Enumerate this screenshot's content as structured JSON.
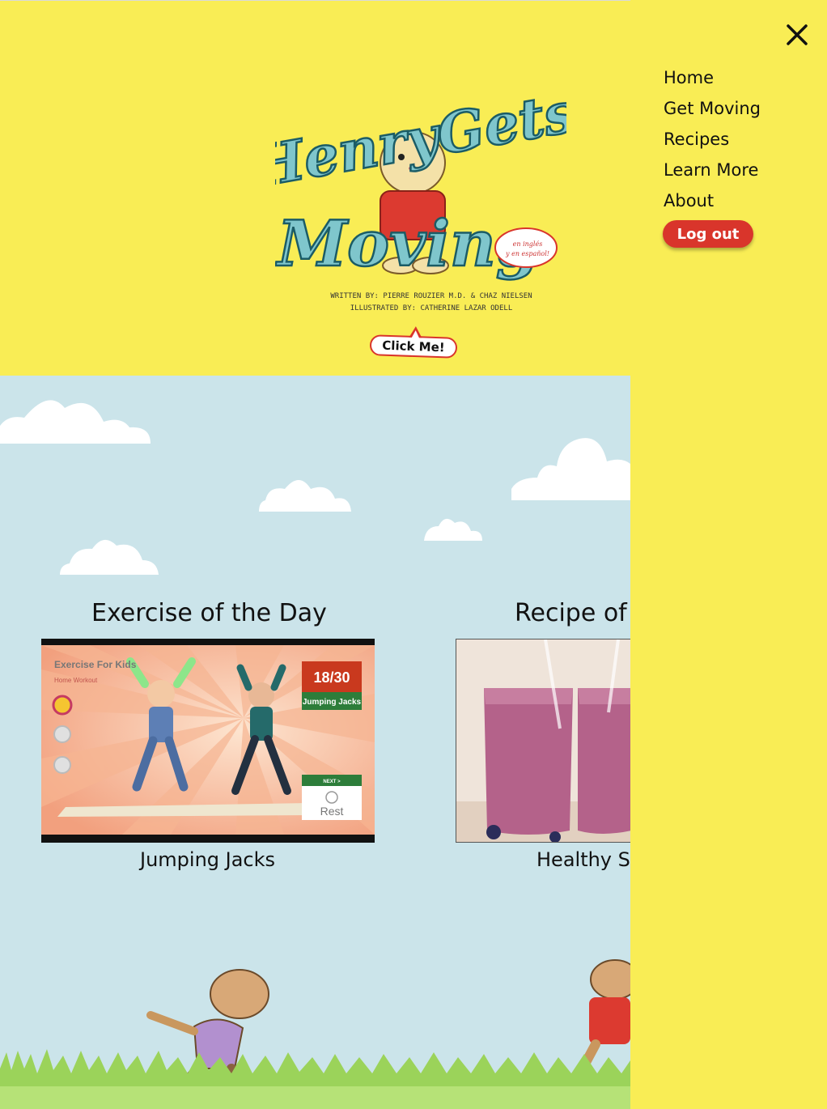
{
  "header": {
    "logo_title_line1": "HenryGets",
    "logo_title_line2": "Moving",
    "logo_bubble_line1": "en inglés",
    "logo_bubble_line2": "y en español!",
    "logo_credit_written": "WRITTEN BY: PIERRE ROUZIER M.D. & CHAZ NIELSEN",
    "logo_credit_illustrated": "ILLUSTRATED BY: CATHERINE LAZAR ODELL",
    "click_me_label": "Click Me!"
  },
  "nav": {
    "close_icon": "close-icon",
    "items": [
      {
        "label": "Home"
      },
      {
        "label": "Get Moving"
      },
      {
        "label": "Recipes"
      },
      {
        "label": "Learn More"
      },
      {
        "label": "About"
      }
    ],
    "logout_label": "Log out"
  },
  "exercise": {
    "section_title": "Exercise of the Day",
    "video_title": "Exercise For Kids",
    "video_subtitle": "Home Workout",
    "counter": "18/30",
    "exercise_label": "Jumping Jacks",
    "next_label": "NEXT >",
    "rest_label": "Rest",
    "caption": "Jumping Jacks"
  },
  "recipe": {
    "section_title": "Recipe of",
    "caption": "Healthy S"
  },
  "colors": {
    "header_yellow": "#f9ed55",
    "sky_blue": "#cbe4ea",
    "accent_red": "#d9352b"
  }
}
